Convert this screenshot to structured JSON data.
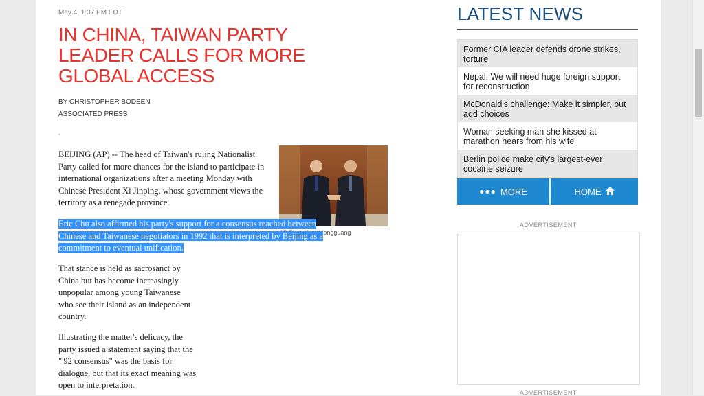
{
  "article": {
    "dateline": "May 4, 1:37 PM EDT",
    "headline": "IN CHINA, TAIWAN PARTY LEADER CALLS FOR MORE GLOBAL ACCESS",
    "byline": "BY CHRISTOPHER BODEEN",
    "agency": "ASSOCIATED PRESS",
    "small_mark": "°",
    "paragraphs": [
      "BEIJING (AP) -- The head of Taiwan's ruling Nationalist Party called for more chances for the island to participate in international organizations after a meeting Monday with Chinese President Xi Jinping, whose government views the territory as a renegade province.",
      "Eric Chu also affirmed his party's support for a consensus reached between Chinese and Taiwanese negotiators in 1992 that is interpreted by Beijing as a commitment to eventual unification.",
      "That stance is held as sacrosanct by China but has become increasingly unpopular among young Taiwanese who see their island as an independent country.",
      "Illustrating the matter's delicacy, the party issued a statement saying that the \"'92 consensus\" was the basis for dialogue, but that its exact meaning was open to interpretation."
    ],
    "photo_caption": "AP Photo/Lan Hongguang"
  },
  "sidebar": {
    "title": "LATEST NEWS",
    "news": [
      "Former CIA leader defends drone strikes, torture",
      "Nepal: We will need huge foreign support for reconstruction",
      "McDonald's challenge: Make it simpler, but add choices",
      "Woman seeking man she kissed at marathon hears from his wife",
      "Berlin police make city's largest-ever cocaine seizure"
    ],
    "more_label": "MORE",
    "home_label": "HOME",
    "ad_label": "ADVERTISEMENT"
  },
  "colors": {
    "headline": "#e8322c",
    "latest_title": "#1a4f80",
    "button": "#1e88d0",
    "selection": "#3390ff"
  },
  "icons": {
    "more": "dots-icon",
    "home": "home-icon"
  }
}
